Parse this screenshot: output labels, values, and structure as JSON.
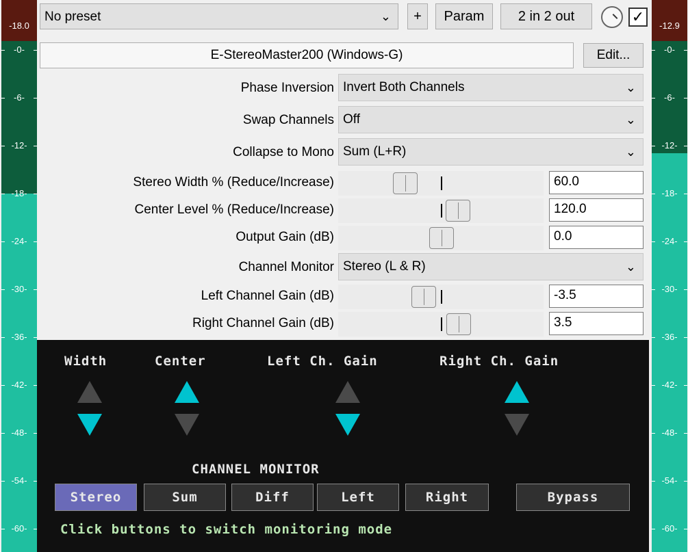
{
  "meters": {
    "left": {
      "peak": "-18.0",
      "level_db": -18.0
    },
    "right": {
      "peak": "-12.9",
      "level_db": -12.9
    },
    "scale": [
      "-0-",
      "-6-",
      "-12-",
      "-18-",
      "-24-",
      "-30-",
      "-36-",
      "-42-",
      "-48-",
      "-54-",
      "-60-"
    ]
  },
  "toolbar": {
    "preset": "No preset",
    "plus_label": "+",
    "param_label": "Param",
    "io_label": "2 in 2 out",
    "enabled_mark": "✓"
  },
  "plugin": {
    "name": "E-StereoMaster200 (Windows-G)",
    "edit_label": "Edit..."
  },
  "params": {
    "phase_inversion": {
      "label": "Phase Inversion",
      "value": "Invert Both Channels"
    },
    "swap_channels": {
      "label": "Swap Channels",
      "value": "Off"
    },
    "collapse_mono": {
      "label": "Collapse to Mono",
      "value": "Sum (L+R)"
    },
    "stereo_width": {
      "label": "Stereo Width % (Reduce/Increase)",
      "value": "60.0"
    },
    "center_level": {
      "label": "Center Level % (Reduce/Increase)",
      "value": "120.0"
    },
    "output_gain": {
      "label": "Output Gain (dB)",
      "value": "0.0"
    },
    "channel_monitor": {
      "label": "Channel Monitor",
      "value": "Stereo (L & R)"
    },
    "left_gain": {
      "label": "Left Channel Gain (dB)",
      "value": "-3.5"
    },
    "right_gain": {
      "label": "Right Channel Gain (dB)",
      "value": "3.5"
    }
  },
  "panel": {
    "headers": {
      "width": "Width",
      "center": "Center",
      "left_gain": "Left Ch. Gain",
      "right_gain": "Right Ch. Gain"
    },
    "indicators": {
      "width": "down",
      "center": "up",
      "left_gain": "down",
      "right_gain": "up"
    },
    "monitor_title": "CHANNEL MONITOR",
    "buttons": {
      "stereo": "Stereo",
      "sum": "Sum",
      "diff": "Diff",
      "left": "Left",
      "right": "Right",
      "bypass": "Bypass"
    },
    "active_mode": "Stereo",
    "hint": "Click buttons to switch monitoring mode"
  },
  "colors": {
    "meter_bright": "#1fbfa0",
    "meter_dark": "#0d5d3c",
    "peak_bg": "#5a1a10",
    "indicator_on": "#00c3cf",
    "indicator_off": "#4a4a4a",
    "active_button": "#6a6ab8",
    "hint_text": "#b9e6b1"
  }
}
